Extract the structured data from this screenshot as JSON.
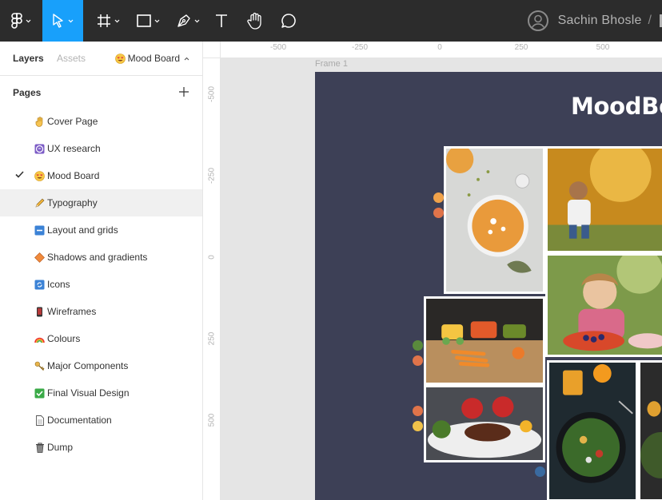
{
  "toolbar": {
    "tools": [
      "figma-menu",
      "move-tool",
      "frame-tool",
      "shape-tool",
      "pen-tool",
      "text-tool",
      "hand-tool",
      "comment-tool"
    ],
    "active_tool": "move-tool",
    "user_name": "Sachin Bhosle",
    "breadcrumb_separator": "/"
  },
  "panel": {
    "tab_layers": "Layers",
    "tab_assets": "Assets",
    "current_page": "Mood Board",
    "pages_title": "Pages",
    "pages": [
      {
        "label": "Cover Page",
        "icon": "hand-emoji",
        "selected": false
      },
      {
        "label": "UX research",
        "icon": "grimace-emoji",
        "selected": false
      },
      {
        "label": "Mood Board",
        "icon": "heart-eyes-emoji",
        "selected": true
      },
      {
        "label": "Typography",
        "icon": "pencil-emoji",
        "selected": false
      },
      {
        "label": "Layout and grids",
        "icon": "minus-square-emoji",
        "selected": false
      },
      {
        "label": "Shadows and gradients",
        "icon": "diamond-emoji",
        "selected": false
      },
      {
        "label": "Icons",
        "icon": "refresh-emoji",
        "selected": false
      },
      {
        "label": "Wireframes",
        "icon": "mobile-emoji",
        "selected": false
      },
      {
        "label": "Colours",
        "icon": "rainbow-emoji",
        "selected": false
      },
      {
        "label": "Major Components",
        "icon": "key-emoji",
        "selected": false
      },
      {
        "label": "Final Visual Design",
        "icon": "check-mark-emoji",
        "selected": false
      },
      {
        "label": "Documentation",
        "icon": "document-emoji",
        "selected": false
      },
      {
        "label": "Dump",
        "icon": "trash-emoji",
        "selected": false
      }
    ]
  },
  "canvas": {
    "ruler_top": [
      "-500",
      "-250",
      "0",
      "250",
      "500"
    ],
    "ruler_left": [
      "-500",
      "-250",
      "0",
      "250",
      "500"
    ],
    "frame_label": "Frame 1",
    "frame_title": "MoodBo",
    "colors": {
      "frame_bg": "#3d4056",
      "accent": "#18a0fb",
      "toolbar_bg": "#2c2c2c"
    }
  }
}
